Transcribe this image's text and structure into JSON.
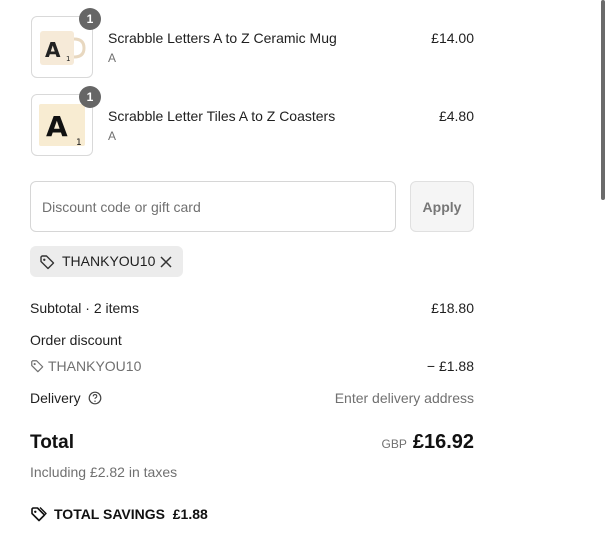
{
  "items": [
    {
      "name": "Scrabble Letters A to Z Ceramic Mug",
      "variant": "A",
      "price": "£14.00",
      "quantity": "1",
      "thumb_letter": "A",
      "thumb_sub": "1"
    },
    {
      "name": "Scrabble Letter Tiles A to Z Coasters",
      "variant": "A",
      "price": "£4.80",
      "quantity": "1",
      "thumb_letter": "A",
      "thumb_sub": "1"
    }
  ],
  "discount": {
    "placeholder": "Discount code or gift card",
    "apply_label": "Apply",
    "applied_code": "THANKYOU10"
  },
  "summary": {
    "subtotal_label": "Subtotal · 2 items",
    "subtotal_value": "£18.80",
    "order_discount_label": "Order discount",
    "discount_code": "THANKYOU10",
    "discount_value": "− £1.88",
    "delivery_label": "Delivery",
    "delivery_value": "Enter delivery address",
    "total_label": "Total",
    "currency": "GBP",
    "total_value": "£16.92",
    "taxes_note": "Including £2.82 in taxes",
    "savings_label": "TOTAL SAVINGS",
    "savings_value": "£1.88"
  },
  "icons": {
    "tag": "tag-icon",
    "close": "close-icon",
    "help": "help-circle-icon",
    "savings_tag": "savings-tag-icon"
  },
  "colors": {
    "quantity_badge": "#666666",
    "chip_background": "#ececec",
    "muted_text": "#707070"
  }
}
